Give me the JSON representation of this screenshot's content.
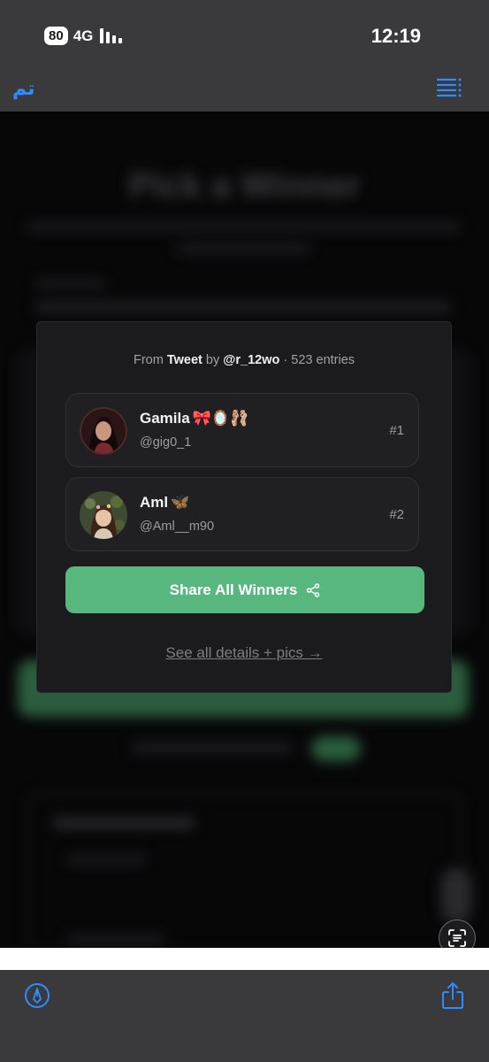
{
  "status_bar": {
    "battery": "80",
    "network": "4G",
    "time": "12:19"
  },
  "nav": {
    "done_label": "تم"
  },
  "background": {
    "title": "Pick a Winner"
  },
  "modal": {
    "source_prefix": "From",
    "source_type": "Tweet",
    "source_by": "by",
    "source_user": "@r_12wo",
    "source_suffix": "· 523 entries",
    "winners": [
      {
        "name": "Gamila",
        "emoji": "🎀🪞🩰",
        "handle": "@gig0_1",
        "rank": "#1"
      },
      {
        "name": "Aml",
        "emoji": "🦋",
        "handle": "@Aml__m90",
        "rank": "#2"
      }
    ],
    "share_label": "Share All Winners",
    "details_link": "See all details + pics →"
  },
  "colors": {
    "accent_blue": "#2f8cff",
    "share_green": "#57b77e",
    "toolbar_gray": "#3a3a3c"
  },
  "icons": {
    "toc": "list-icon",
    "share_small": "share-nodes-icon",
    "scan": "live-text-icon",
    "markup": "markup-pen-icon",
    "share_sheet": "share-sheet-icon"
  }
}
